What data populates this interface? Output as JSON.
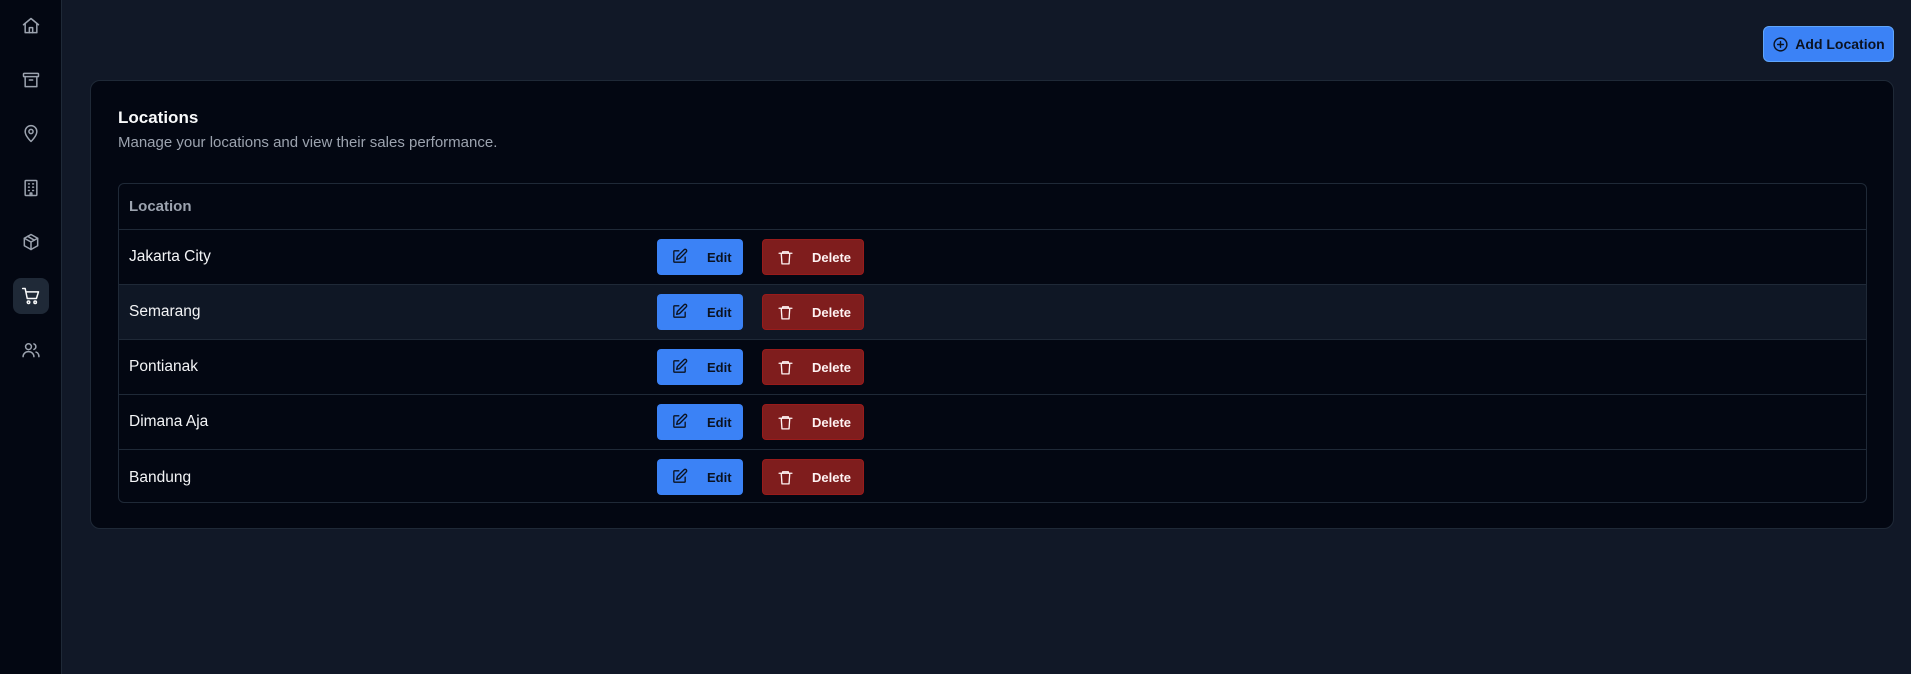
{
  "toolbar": {
    "add_location_label": "Add Location"
  },
  "sidebar": {
    "items": [
      {
        "icon": "home-icon"
      },
      {
        "icon": "archive-icon"
      },
      {
        "icon": "map-pin-icon"
      },
      {
        "icon": "building-icon"
      },
      {
        "icon": "package-icon"
      },
      {
        "icon": "shopping-cart-icon",
        "active": true
      },
      {
        "icon": "users-icon"
      }
    ]
  },
  "card": {
    "title": "Locations",
    "description": "Manage your locations and view their sales performance."
  },
  "table": {
    "header": "Location",
    "edit_label": "Edit",
    "delete_label": "Delete",
    "rows": [
      "Jakarta City",
      "Semarang",
      "Pontianak",
      "Dimana Aja",
      "Bandung"
    ]
  },
  "colors": {
    "primary": "#3b82f6",
    "danger": "#7f1d1d",
    "background": "#111827",
    "card": "#030712"
  }
}
